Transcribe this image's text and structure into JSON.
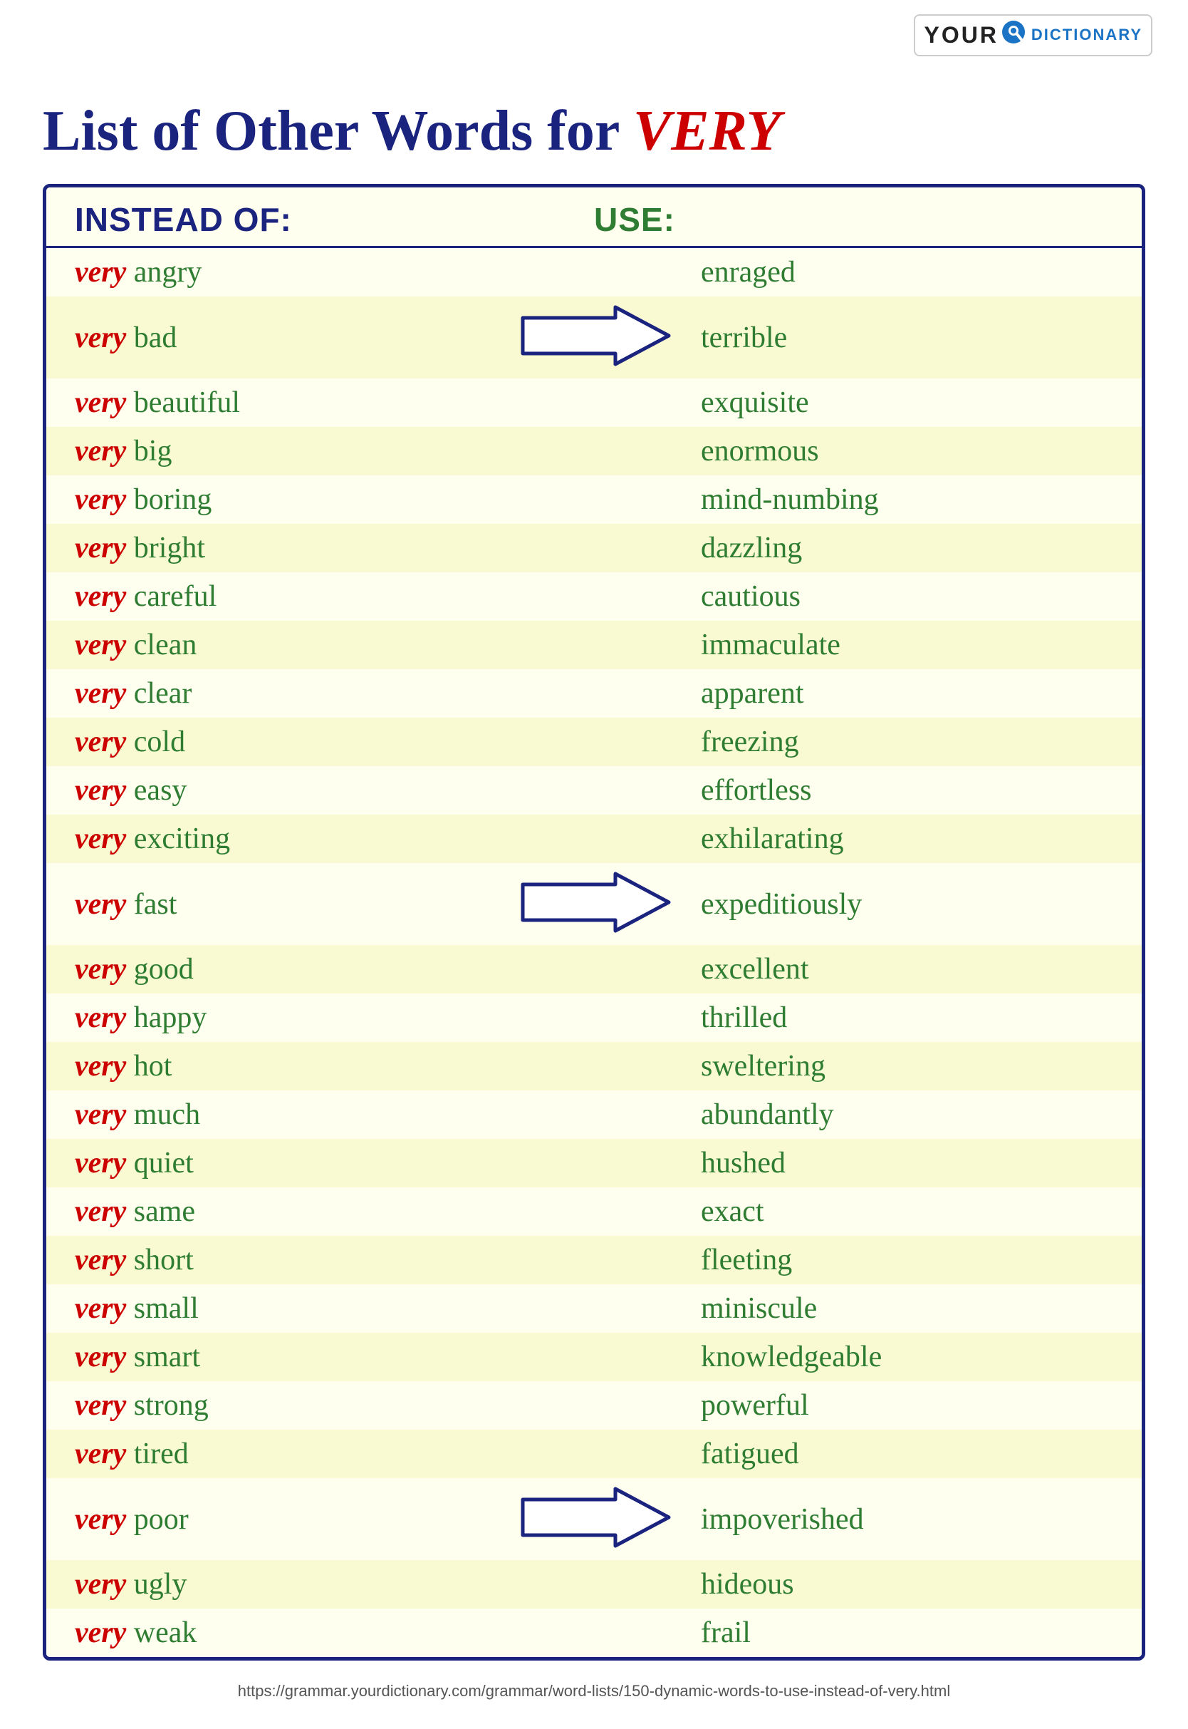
{
  "logo": {
    "your_text": "YOUR",
    "dictionary_text": "DICTIONARY"
  },
  "title": {
    "prefix": "List of Other Words for ",
    "highlight": "VERY"
  },
  "table": {
    "header_instead": "INSTEAD OF:",
    "header_use": "USE:"
  },
  "words": [
    {
      "instead": "very angry",
      "use": "enraged",
      "arrow": false
    },
    {
      "instead": "very bad",
      "use": "terrible",
      "arrow": true,
      "arrowIndex": 1
    },
    {
      "instead": "very beautiful",
      "use": "exquisite",
      "arrow": false
    },
    {
      "instead": "very big",
      "use": "enormous",
      "arrow": false
    },
    {
      "instead": "very boring",
      "use": "mind-numbing",
      "arrow": false
    },
    {
      "instead": "very bright",
      "use": "dazzling",
      "arrow": false
    },
    {
      "instead": "very careful",
      "use": "cautious",
      "arrow": false
    },
    {
      "instead": "very clean",
      "use": "immaculate",
      "arrow": false
    },
    {
      "instead": "very clear",
      "use": "apparent",
      "arrow": false
    },
    {
      "instead": "very cold",
      "use": "freezing",
      "arrow": false
    },
    {
      "instead": "very easy",
      "use": "effortless",
      "arrow": false
    },
    {
      "instead": "very exciting",
      "use": "exhilarating",
      "arrow": false
    },
    {
      "instead": "very fast",
      "use": "expeditiously",
      "arrow": true,
      "arrowIndex": 2
    },
    {
      "instead": "very good",
      "use": "excellent",
      "arrow": false
    },
    {
      "instead": "very happy",
      "use": "thrilled",
      "arrow": false
    },
    {
      "instead": "very hot",
      "use": "sweltering",
      "arrow": false
    },
    {
      "instead": "very much",
      "use": "abundantly",
      "arrow": false
    },
    {
      "instead": "very quiet",
      "use": "hushed",
      "arrow": false
    },
    {
      "instead": "very same",
      "use": "exact",
      "arrow": false
    },
    {
      "instead": "very short",
      "use": "fleeting",
      "arrow": false
    },
    {
      "instead": "very small",
      "use": "miniscule",
      "arrow": false
    },
    {
      "instead": "very smart",
      "use": "knowledgeable",
      "arrow": false
    },
    {
      "instead": "very strong",
      "use": "powerful",
      "arrow": false
    },
    {
      "instead": "very tired",
      "use": "fatigued",
      "arrow": false
    },
    {
      "instead": "very poor",
      "use": "impoverished",
      "arrow": true,
      "arrowIndex": 3
    },
    {
      "instead": "very ugly",
      "use": "hideous",
      "arrow": false
    },
    {
      "instead": "very weak",
      "use": "frail",
      "arrow": false
    }
  ],
  "footer": {
    "url": "https://grammar.yourdictionary.com/grammar/word-lists/150-dynamic-words-to-use-instead-of-very.html"
  }
}
